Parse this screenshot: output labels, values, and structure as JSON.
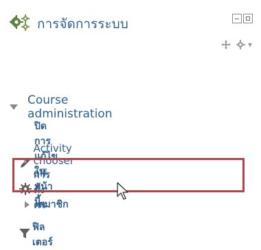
{
  "block": {
    "title": "การจัดการระบบ",
    "icon": "gears-icon"
  },
  "tree": {
    "course_admin_label": "Course administration",
    "items": [
      {
        "label": "ปิดการแก้ไขในหน้านี้",
        "icon": "pencil-icon"
      },
      {
        "label": "Activity chooser off",
        "icon": "bullet"
      },
      {
        "label": "การตั้งค่า",
        "icon": "gear-icon"
      },
      {
        "label": "สมาชิก",
        "icon": "expand-right-arrow"
      },
      {
        "label": "ฟิลเตอร์",
        "icon": "filter-icon"
      }
    ]
  },
  "colors": {
    "link": "#2f5f8c",
    "highlight": "#b1434a",
    "icon": "#666666"
  }
}
